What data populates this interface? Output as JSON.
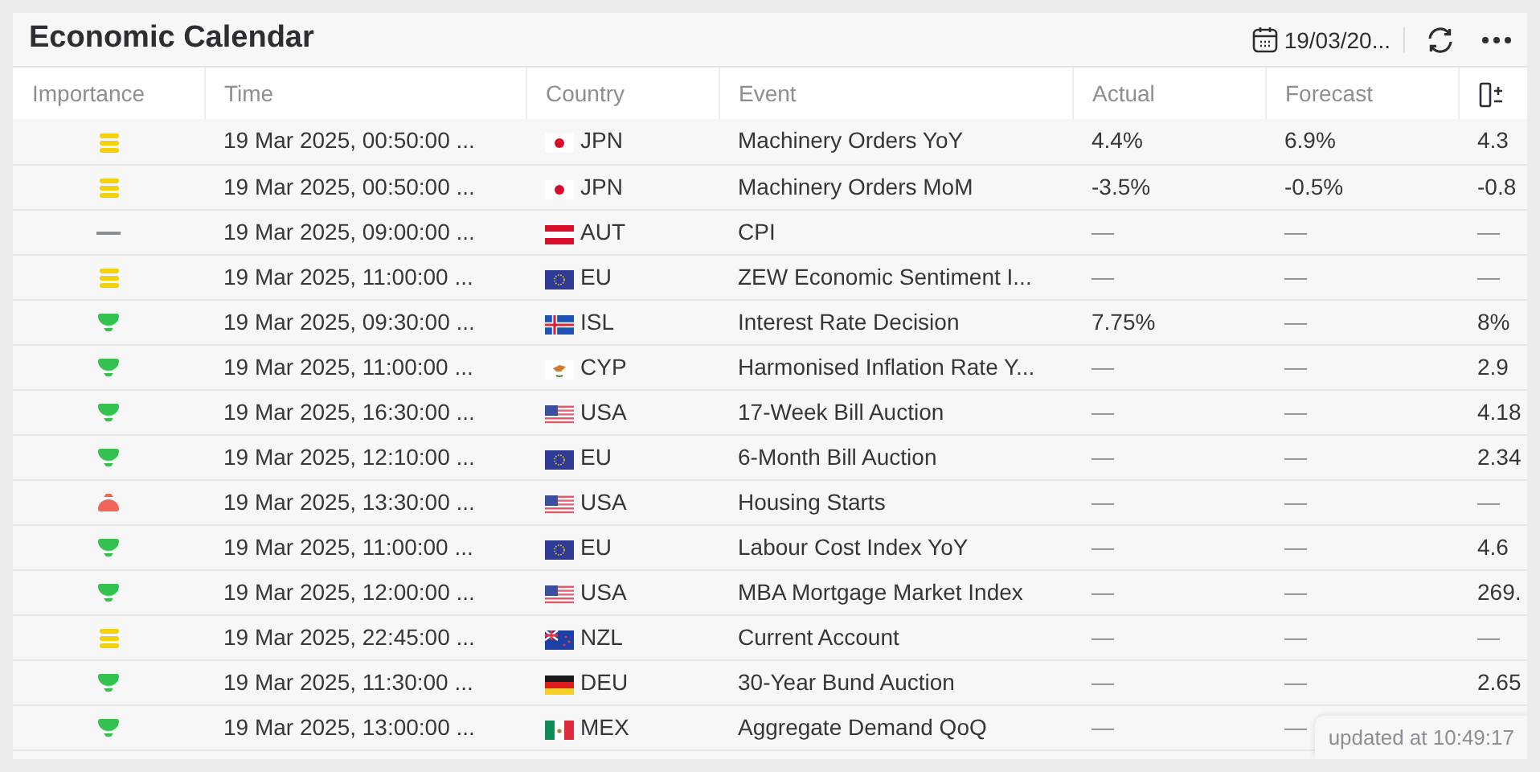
{
  "window": {
    "title": "Economic Calendar"
  },
  "toolbar": {
    "date": "19/03/20..."
  },
  "table": {
    "columns": [
      "Importance",
      "Time",
      "Country",
      "Event",
      "Actual",
      "Forecast"
    ],
    "rows": [
      {
        "importance": {
          "kind": "medium"
        },
        "time": "19 Mar 2025, 00:50:00 ...",
        "flag": {
          "kind": "japan"
        },
        "country": "JPN",
        "event": "Machinery Orders YoY",
        "actual": "4.4%",
        "forecast": "6.9%",
        "column_7": "4.3"
      },
      {
        "importance": {
          "kind": "medium"
        },
        "time": "19 Mar 2025, 00:50:00 ...",
        "flag": {
          "kind": "japan"
        },
        "country": "JPN",
        "event": "Machinery Orders MoM",
        "actual": "-3.5%",
        "forecast": "-0.5%",
        "column_7": "-0.8"
      },
      {
        "importance": {
          "kind": "none"
        },
        "time": "19 Mar 2025, 09:00:00 ...",
        "flag": {
          "kind": "austria"
        },
        "country": "AUT",
        "event": "CPI",
        "actual": "—",
        "forecast": "—",
        "column_7": "—"
      },
      {
        "importance": {
          "kind": "medium"
        },
        "time": "19 Mar 2025, 11:00:00 ...",
        "flag": {
          "kind": "eu"
        },
        "country": "EU",
        "event": "ZEW Economic Sentiment I...",
        "actual": "—",
        "forecast": "—",
        "column_7": "—"
      },
      {
        "importance": {
          "kind": "low"
        },
        "time": "19 Mar 2025, 09:30:00 ...",
        "flag": {
          "kind": "iceland"
        },
        "country": "ISL",
        "event": "Interest Rate Decision",
        "actual": "7.75%",
        "forecast": "—",
        "column_7": "8%"
      },
      {
        "importance": {
          "kind": "low"
        },
        "time": "19 Mar 2025, 11:00:00 ...",
        "flag": {
          "kind": "cyprus"
        },
        "country": "CYP",
        "event": "Harmonised Inflation Rate Y...",
        "actual": "—",
        "forecast": "—",
        "column_7": "2.9"
      },
      {
        "importance": {
          "kind": "low"
        },
        "time": "19 Mar 2025, 16:30:00 ...",
        "flag": {
          "kind": "usa"
        },
        "country": "USA",
        "event": "17-Week Bill Auction",
        "actual": "—",
        "forecast": "—",
        "column_7": "4.18"
      },
      {
        "importance": {
          "kind": "low"
        },
        "time": "19 Mar 2025, 12:10:00 ...",
        "flag": {
          "kind": "eu"
        },
        "country": "EU",
        "event": "6-Month Bill Auction",
        "actual": "—",
        "forecast": "—",
        "column_7": "2.34"
      },
      {
        "importance": {
          "kind": "high"
        },
        "time": "19 Mar 2025, 13:30:00 ...",
        "flag": {
          "kind": "usa"
        },
        "country": "USA",
        "event": "Housing Starts",
        "actual": "—",
        "forecast": "—",
        "column_7": "—"
      },
      {
        "importance": {
          "kind": "low"
        },
        "time": "19 Mar 2025, 11:00:00 ...",
        "flag": {
          "kind": "eu"
        },
        "country": "EU",
        "event": "Labour Cost Index YoY",
        "actual": "—",
        "forecast": "—",
        "column_7": "4.6"
      },
      {
        "importance": {
          "kind": "low"
        },
        "time": "19 Mar 2025, 12:00:00 ...",
        "flag": {
          "kind": "usa"
        },
        "country": "USA",
        "event": "MBA Mortgage Market Index",
        "actual": "—",
        "forecast": "—",
        "column_7": "269."
      },
      {
        "importance": {
          "kind": "medium"
        },
        "time": "19 Mar 2025, 22:45:00 ...",
        "flag": {
          "kind": "newzealand"
        },
        "country": "NZL",
        "event": "Current Account",
        "actual": "—",
        "forecast": "—",
        "column_7": "—"
      },
      {
        "importance": {
          "kind": "low"
        },
        "time": "19 Mar 2025, 11:30:00 ...",
        "flag": {
          "kind": "germany"
        },
        "country": "DEU",
        "event": "30-Year Bund Auction",
        "actual": "—",
        "forecast": "—",
        "column_7": "2.65"
      },
      {
        "importance": {
          "kind": "low"
        },
        "time": "19 Mar 2025, 13:00:00 ...",
        "flag": {
          "kind": "mexico"
        },
        "country": "MEX",
        "event": "Aggregate Demand QoQ",
        "actual": "—",
        "forecast": "—"
      }
    ]
  },
  "status": {
    "text": "updated at 10:49:17"
  }
}
